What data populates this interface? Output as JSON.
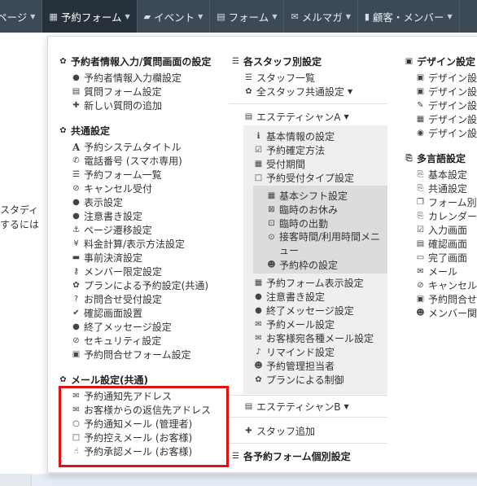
{
  "navbar": {
    "items": [
      {
        "label": "ページ",
        "icon": "",
        "active": false
      },
      {
        "label": "予約フォーム",
        "icon": "▦",
        "active": true
      },
      {
        "label": "イベント",
        "icon": "▰",
        "active": false
      },
      {
        "label": "フォーム",
        "icon": "▤",
        "active": false
      },
      {
        "label": "メルマガ",
        "icon": "✉",
        "active": false
      },
      {
        "label": "顧客・メンバー",
        "icon": "▮",
        "active": false
      }
    ]
  },
  "background": {
    "line1": "スタディ",
    "line2": "するには"
  },
  "menu": {
    "col1": {
      "section1": {
        "title": "予約者情報入力/質問画面の設定",
        "items": [
          "予約者情報入力欄設定",
          "質問フォーム設定",
          "新しい質問の追加"
        ]
      },
      "section2": {
        "title": "共通設定",
        "items": [
          "予約システムタイトル",
          "電話番号 (スマホ専用)",
          "予約フォーム一覧",
          "キャンセル受付",
          "表示設定",
          "注意書き設定",
          "ページ遷移設定",
          "料金計算/表示方法設定",
          "事前決済設定",
          "メンバー限定設定",
          "プランによる予約設定(共通)",
          "お問合せ受付設定",
          "確認画面設置",
          "終了メッセージ設定",
          "セキュリティ設定",
          "予約問合せフォーム設定"
        ]
      },
      "section3": {
        "title": "メール設定(共通)",
        "items": [
          "予約通知先アドレス",
          "お客様からの返信先アドレス",
          "予約通知メール (管理者)",
          "予約控えメール (お客様)",
          "予約承認メール (お客様)"
        ]
      }
    },
    "col2": {
      "title": "各スタッフ別設定",
      "items": [
        "スタッフ一覧",
        "全スタッフ共通設定"
      ],
      "staffA": {
        "label": "エステティシャンA",
        "items": [
          "基本情報の設定",
          "予約確定方法",
          "受付期間",
          "予約受付タイプ設定"
        ],
        "sub_items": [
          "基本シフト設定",
          "臨時のお休み",
          "臨時の出勤",
          "接客時間/利用時間メニュー",
          "予約枠の設定"
        ],
        "items2": [
          "予約フォーム表示設定",
          "注意書き設定",
          "終了メッセージ設定",
          "予約メール設定",
          "お客様宛各種メール設定",
          "リマインド設定",
          "予約管理担当者",
          "プランによる制御"
        ]
      },
      "staffB": {
        "label": "エステティシャンB"
      },
      "add_staff": "スタッフ追加",
      "footer_title": "各予約フォーム個別設定"
    },
    "col3": {
      "section1": {
        "title": "デザイン設定",
        "items": [
          "デザイン設",
          "デザイン設",
          "デザイン設",
          "デザイン設",
          "デザイン設"
        ]
      },
      "section2": {
        "title": "多言語設定",
        "items": [
          "基本設定",
          "共通設定",
          "フォーム別",
          "カレンダー",
          "入力画面",
          "確認画面",
          "完了画面",
          "メール",
          "キャンセル",
          "予約問合せ",
          "メンバー関"
        ]
      }
    }
  },
  "colors": {
    "navbar_bg": "#3c4a58",
    "navbar_active": "#26313c",
    "highlight_border": "#e01010"
  }
}
